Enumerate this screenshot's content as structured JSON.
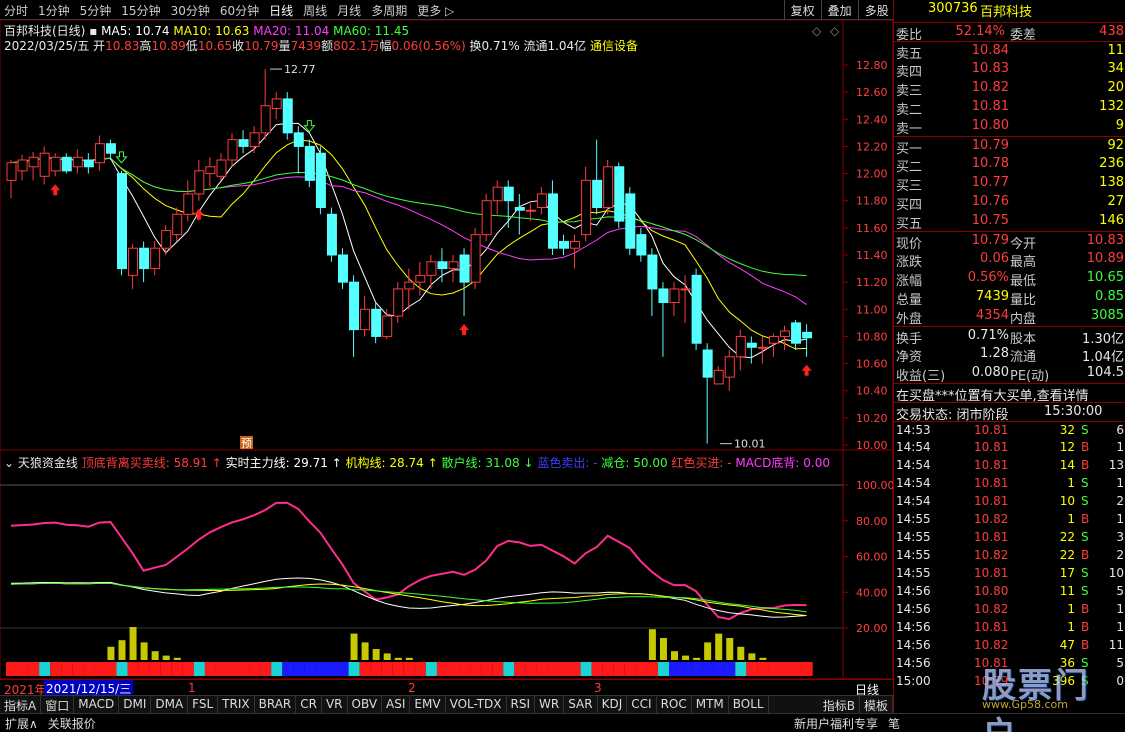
{
  "app": {
    "periods": [
      "分时",
      "1分钟",
      "5分钟",
      "15分钟",
      "30分钟",
      "60分钟",
      "日线",
      "周线",
      "月线",
      "多周期",
      "更多 ▷"
    ],
    "active_period": "日线",
    "tools": [
      "复权",
      "叠加",
      "多股",
      "统计",
      "画线",
      "F10",
      "标记",
      "+自选",
      "返回"
    ]
  },
  "kline": {
    "title": "百邦科技(日线)",
    "ma": [
      {
        "label": "MA5: 10.74",
        "color": "#ffffff"
      },
      {
        "label": "MA10: 10.63",
        "color": "#ffff00"
      },
      {
        "label": "MA20: 11.04",
        "color": "#ff3cff"
      },
      {
        "label": "MA60: 11.45",
        "color": "#3cff3c"
      }
    ],
    "date": "2022/03/25/五",
    "ohlc": [
      {
        "k": "开",
        "v": "10.83"
      },
      {
        "k": "高",
        "v": "10.89"
      },
      {
        "k": "低",
        "v": "10.65"
      },
      {
        "k": "收",
        "v": "10.79"
      },
      {
        "k": "量",
        "v": "7439"
      },
      {
        "k": "额",
        "v": "802.1万"
      },
      {
        "k": "幅",
        "v": "0.06(0.56%)"
      }
    ],
    "turnover": "换0.71% 流通1.04亿",
    "sector": "通信设备",
    "high_label": "12.77",
    "low_label": "10.01",
    "pre_marker": "预",
    "y_ticks": [
      "12.80",
      "12.60",
      "12.40",
      "12.20",
      "12.00",
      "11.80",
      "11.60",
      "11.40",
      "11.20",
      "11.00",
      "10.80",
      "10.60",
      "10.40",
      "10.20",
      "10.00"
    ]
  },
  "chart_data": {
    "type": "candlestick",
    "ylim": [
      10.0,
      12.8
    ],
    "candles": [
      [
        11.95,
        12.08,
        11.82,
        12.1
      ],
      [
        12.02,
        12.1,
        11.95,
        12.14
      ],
      [
        12.05,
        12.12,
        11.95,
        12.16
      ],
      [
        11.98,
        12.15,
        11.92,
        12.2
      ],
      [
        12.02,
        12.12,
        11.98,
        12.15
      ],
      [
        12.12,
        12.02,
        12.0,
        12.15
      ],
      [
        12.05,
        12.12,
        12.0,
        12.18
      ],
      [
        12.1,
        12.05,
        12.0,
        12.15
      ],
      [
        12.08,
        12.22,
        12.02,
        12.28
      ],
      [
        12.22,
        12.15,
        12.1,
        12.25
      ],
      [
        12.0,
        11.3,
        11.25,
        12.02
      ],
      [
        11.25,
        11.45,
        11.15,
        11.48
      ],
      [
        11.45,
        11.3,
        11.2,
        11.5
      ],
      [
        11.3,
        11.45,
        11.25,
        11.5
      ],
      [
        11.45,
        11.58,
        11.4,
        11.62
      ],
      [
        11.55,
        11.7,
        11.5,
        11.75
      ],
      [
        11.7,
        11.85,
        11.65,
        11.95
      ],
      [
        11.85,
        12.02,
        11.8,
        12.1
      ],
      [
        12.0,
        12.05,
        11.9,
        12.12
      ],
      [
        11.98,
        12.1,
        11.95,
        12.15
      ],
      [
        12.1,
        12.25,
        12.05,
        12.3
      ],
      [
        12.25,
        12.2,
        12.15,
        12.32
      ],
      [
        12.2,
        12.3,
        12.15,
        12.35
      ],
      [
        12.3,
        12.5,
        12.25,
        12.77
      ],
      [
        12.48,
        12.55,
        12.4,
        12.6
      ],
      [
        12.55,
        12.3,
        12.25,
        12.6
      ],
      [
        12.3,
        12.2,
        12.0,
        12.35
      ],
      [
        12.2,
        11.95,
        11.9,
        12.25
      ],
      [
        12.15,
        11.75,
        11.7,
        12.2
      ],
      [
        11.7,
        11.4,
        11.35,
        11.75
      ],
      [
        11.4,
        11.2,
        11.15,
        11.45
      ],
      [
        11.2,
        10.85,
        10.65,
        11.25
      ],
      [
        10.85,
        11.0,
        10.8,
        11.1
      ],
      [
        11.0,
        10.8,
        10.75,
        11.05
      ],
      [
        10.8,
        10.95,
        10.78,
        11.0
      ],
      [
        10.95,
        11.15,
        10.9,
        11.2
      ],
      [
        11.15,
        11.2,
        11.0,
        11.3
      ],
      [
        11.2,
        11.25,
        11.1,
        11.35
      ],
      [
        11.25,
        11.35,
        11.15,
        11.4
      ],
      [
        11.35,
        11.3,
        11.2,
        11.45
      ],
      [
        11.3,
        11.35,
        11.2,
        11.4
      ],
      [
        11.4,
        11.2,
        10.95,
        11.45
      ],
      [
        11.2,
        11.55,
        11.15,
        11.6
      ],
      [
        11.55,
        11.8,
        11.5,
        11.85
      ],
      [
        11.8,
        11.9,
        11.7,
        11.95
      ],
      [
        11.9,
        11.8,
        11.6,
        11.95
      ],
      [
        11.75,
        11.73,
        11.55,
        11.85
      ],
      [
        11.73,
        11.73,
        11.65,
        11.78
      ],
      [
        11.75,
        11.85,
        11.7,
        11.9
      ],
      [
        11.85,
        11.45,
        11.4,
        11.95
      ],
      [
        11.5,
        11.45,
        11.4,
        11.55
      ],
      [
        11.45,
        11.5,
        11.3,
        11.55
      ],
      [
        11.55,
        11.95,
        11.5,
        12.05
      ],
      [
        11.95,
        11.75,
        11.7,
        12.25
      ],
      [
        11.75,
        12.05,
        11.7,
        12.1
      ],
      [
        12.05,
        11.65,
        11.6,
        12.08
      ],
      [
        11.85,
        11.45,
        11.4,
        11.9
      ],
      [
        11.55,
        11.4,
        11.35,
        11.6
      ],
      [
        11.4,
        11.15,
        10.95,
        11.45
      ],
      [
        11.15,
        11.05,
        10.65,
        11.2
      ],
      [
        11.05,
        11.15,
        10.95,
        11.2
      ],
      [
        11.15,
        11.15,
        10.9,
        11.25
      ],
      [
        11.25,
        10.75,
        10.7,
        11.3
      ],
      [
        10.7,
        10.5,
        10.01,
        10.75
      ],
      [
        10.45,
        10.55,
        10.45,
        10.58
      ],
      [
        10.5,
        10.65,
        10.4,
        10.7
      ],
      [
        10.65,
        10.8,
        10.55,
        10.85
      ],
      [
        10.75,
        10.72,
        10.6,
        10.8
      ],
      [
        10.72,
        10.72,
        10.6,
        10.8
      ],
      [
        10.75,
        10.8,
        10.65,
        10.82
      ],
      [
        10.8,
        10.84,
        10.7,
        10.88
      ],
      [
        10.9,
        10.75,
        10.7,
        10.92
      ],
      [
        10.83,
        10.79,
        10.65,
        10.89
      ]
    ]
  },
  "indicator": {
    "title": "天狼资金线",
    "items": [
      {
        "label": "顶底背离买卖线: 58.91",
        "color": "#ff3c3c",
        "arrow": "↑"
      },
      {
        "label": "实时主力线: 29.71",
        "color": "#ffffff",
        "arrow": "↑"
      },
      {
        "label": "机构线: 28.74",
        "color": "#ffff00",
        "arrow": "↑"
      },
      {
        "label": "散户线: 31.08",
        "color": "#3cff3c",
        "arrow": "↓"
      },
      {
        "label": "蓝色卖出:",
        "color": "#3c3cff",
        "arrow": "-"
      },
      {
        "label": "减仓: 50.00",
        "color": "#3cff3c",
        "arrow": ""
      },
      {
        "label": "红色买进:",
        "color": "#ff3c3c",
        "arrow": "-"
      },
      {
        "label": "MACD底背: 0.00",
        "color": "#ff3cff",
        "arrow": ""
      }
    ],
    "y_ticks": [
      "100.00",
      "80.00",
      "60.00",
      "40.00",
      "20.00"
    ]
  },
  "bottom": {
    "year": "2021年",
    "date": "2021/12/15/三",
    "months": [
      "1",
      "2",
      "3"
    ],
    "period_label": "日线",
    "tabs": [
      "指标A",
      "窗口",
      "MACD",
      "DMI",
      "DMA",
      "FSL",
      "TRIX",
      "BRAR",
      "CR",
      "VR",
      "OBV",
      "ASI",
      "EMV",
      "VOL-TDX",
      "RSI",
      "WR",
      "SAR",
      "KDJ",
      "CCI",
      "ROC",
      "MTM",
      "BOLL"
    ],
    "tabs_right": [
      "指标B",
      "模板"
    ],
    "bar3": [
      "扩展∧",
      "关联报价"
    ],
    "bar3_right": [
      "新用户福利专享",
      "笔"
    ]
  },
  "quote": {
    "code": "300736",
    "name": "百邦科技",
    "weibi_label": "委比",
    "weibi": "52.14%",
    "weicha_label": "委差",
    "weicha": "438",
    "asks": [
      {
        "l": "卖五",
        "p": "10.84",
        "v": "11"
      },
      {
        "l": "卖四",
        "p": "10.83",
        "v": "34"
      },
      {
        "l": "卖三",
        "p": "10.82",
        "v": "20"
      },
      {
        "l": "卖二",
        "p": "10.81",
        "v": "132"
      },
      {
        "l": "卖一",
        "p": "10.80",
        "v": "9"
      }
    ],
    "bids": [
      {
        "l": "买一",
        "p": "10.79",
        "v": "92"
      },
      {
        "l": "买二",
        "p": "10.78",
        "v": "236"
      },
      {
        "l": "买三",
        "p": "10.77",
        "v": "138"
      },
      {
        "l": "买四",
        "p": "10.76",
        "v": "27"
      },
      {
        "l": "买五",
        "p": "10.75",
        "v": "146"
      }
    ],
    "stats": [
      {
        "l1": "现价",
        "v1": "10.79",
        "c1": "red",
        "l2": "今开",
        "v2": "10.83",
        "c2": "red"
      },
      {
        "l1": "涨跌",
        "v1": "0.06",
        "c1": "red",
        "l2": "最高",
        "v2": "10.89",
        "c2": "red"
      },
      {
        "l1": "涨幅",
        "v1": "0.56%",
        "c1": "red",
        "l2": "最低",
        "v2": "10.65",
        "c2": "green"
      },
      {
        "l1": "总量",
        "v1": "7439",
        "c1": "yel",
        "l2": "量比",
        "v2": "0.85",
        "c2": "green"
      },
      {
        "l1": "外盘",
        "v1": "4354",
        "c1": "red",
        "l2": "内盘",
        "v2": "3085",
        "c2": "green"
      }
    ],
    "stats2": [
      {
        "l1": "换手",
        "v1": "0.71%",
        "l2": "股本",
        "v2": "1.30亿"
      },
      {
        "l1": "净资",
        "v1": "1.28",
        "l2": "流通",
        "v2": "1.04亿"
      },
      {
        "l1": "收益(三)",
        "v1": "0.080",
        "l2": "PE(动)",
        "v2": "104.5"
      }
    ],
    "notice": "在买盘***位置有大买单,查看详情",
    "status_label": "交易状态: 闭市阶段",
    "status_time": "15:30:00",
    "ticks": [
      {
        "t": "14:53",
        "p": "10.81",
        "v": "32",
        "s": "S",
        "n": "6"
      },
      {
        "t": "14:54",
        "p": "10.81",
        "v": "12",
        "s": "B",
        "n": "1"
      },
      {
        "t": "14:54",
        "p": "10.81",
        "v": "14",
        "s": "B",
        "n": "13"
      },
      {
        "t": "14:54",
        "p": "10.81",
        "v": "1",
        "s": "S",
        "n": "1"
      },
      {
        "t": "14:54",
        "p": "10.81",
        "v": "10",
        "s": "S",
        "n": "2"
      },
      {
        "t": "14:55",
        "p": "10.82",
        "v": "1",
        "s": "B",
        "n": "1"
      },
      {
        "t": "14:55",
        "p": "10.81",
        "v": "22",
        "s": "S",
        "n": "3"
      },
      {
        "t": "14:55",
        "p": "10.82",
        "v": "22",
        "s": "B",
        "n": "2"
      },
      {
        "t": "14:55",
        "p": "10.81",
        "v": "17",
        "s": "S",
        "n": "10"
      },
      {
        "t": "14:56",
        "p": "10.80",
        "v": "11",
        "s": "S",
        "n": "5"
      },
      {
        "t": "14:56",
        "p": "10.82",
        "v": "1",
        "s": "B",
        "n": "1"
      },
      {
        "t": "14:56",
        "p": "10.81",
        "v": "1",
        "s": "B",
        "n": "1"
      },
      {
        "t": "14:56",
        "p": "10.82",
        "v": "47",
        "s": "B",
        "n": "11"
      },
      {
        "t": "14:56",
        "p": "10.81",
        "v": "36",
        "s": "S",
        "n": "5"
      },
      {
        "t": "15:00",
        "p": "10.79",
        "v": "396",
        "s": "S",
        "n": "0"
      }
    ],
    "watermark": "股票门户",
    "watermark_url": "www.Gp58.com"
  }
}
